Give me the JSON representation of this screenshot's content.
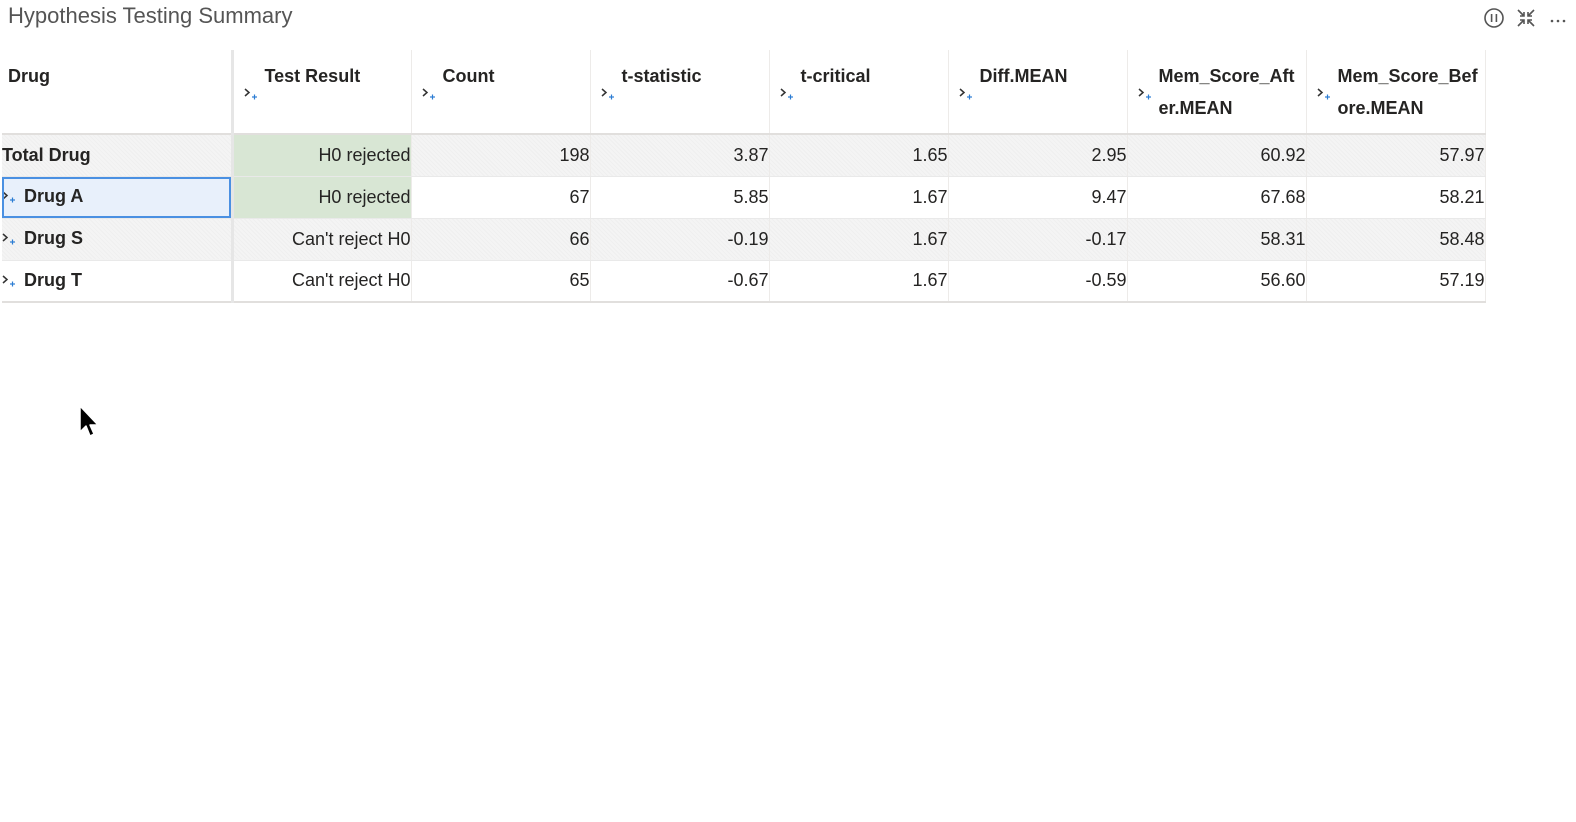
{
  "visual": {
    "title": "Hypothesis Testing Summary",
    "header_icons": [
      "pause-icon",
      "collapse-icon",
      "more-options-icon"
    ]
  },
  "table": {
    "row_header_label": "Drug",
    "columns": [
      "Test Result",
      "Count",
      "t-statistic",
      "t-critical",
      "Diff.MEAN",
      "Mem_Score_After.MEAN",
      "Mem_Score_Before.MEAN"
    ],
    "rows": [
      {
        "label": "Total Drug",
        "expandable": false,
        "cells": [
          "H0 rejected",
          "198",
          "3.87",
          "1.65",
          "2.95",
          "60.92",
          "57.97"
        ]
      },
      {
        "label": "Drug A",
        "expandable": true,
        "cells": [
          "H0 rejected",
          "67",
          "5.85",
          "1.67",
          "9.47",
          "67.68",
          "58.21"
        ]
      },
      {
        "label": "Drug S",
        "expandable": true,
        "cells": [
          "Can't reject H0",
          "66",
          "-0.19",
          "1.67",
          "-0.17",
          "58.31",
          "58.48"
        ]
      },
      {
        "label": "Drug T",
        "expandable": true,
        "cells": [
          "Can't reject H0",
          "65",
          "-0.67",
          "1.67",
          "-0.59",
          "56.60",
          "57.19"
        ]
      }
    ]
  },
  "colors": {
    "rejected_highlight": "#d8e6d4",
    "selection_border": "#4a90e2",
    "expand_icon_plus": "#2b7cd3"
  }
}
